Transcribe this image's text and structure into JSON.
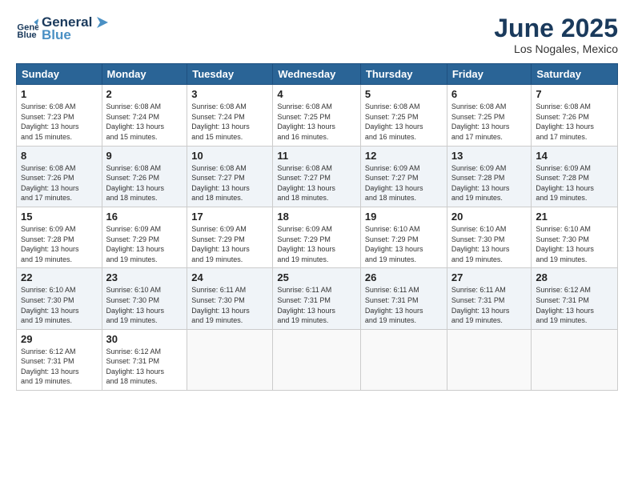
{
  "logo": {
    "line1": "General",
    "line2": "Blue"
  },
  "title": "June 2025",
  "location": "Los Nogales, Mexico",
  "weekdays": [
    "Sunday",
    "Monday",
    "Tuesday",
    "Wednesday",
    "Thursday",
    "Friday",
    "Saturday"
  ],
  "weeks": [
    [
      {
        "day": "1",
        "sunrise": "6:08 AM",
        "sunset": "7:23 PM",
        "daylight": "13 hours and 15 minutes."
      },
      {
        "day": "2",
        "sunrise": "6:08 AM",
        "sunset": "7:24 PM",
        "daylight": "13 hours and 15 minutes."
      },
      {
        "day": "3",
        "sunrise": "6:08 AM",
        "sunset": "7:24 PM",
        "daylight": "13 hours and 15 minutes."
      },
      {
        "day": "4",
        "sunrise": "6:08 AM",
        "sunset": "7:25 PM",
        "daylight": "13 hours and 16 minutes."
      },
      {
        "day": "5",
        "sunrise": "6:08 AM",
        "sunset": "7:25 PM",
        "daylight": "13 hours and 16 minutes."
      },
      {
        "day": "6",
        "sunrise": "6:08 AM",
        "sunset": "7:25 PM",
        "daylight": "13 hours and 17 minutes."
      },
      {
        "day": "7",
        "sunrise": "6:08 AM",
        "sunset": "7:26 PM",
        "daylight": "13 hours and 17 minutes."
      }
    ],
    [
      {
        "day": "8",
        "sunrise": "6:08 AM",
        "sunset": "7:26 PM",
        "daylight": "13 hours and 17 minutes."
      },
      {
        "day": "9",
        "sunrise": "6:08 AM",
        "sunset": "7:26 PM",
        "daylight": "13 hours and 18 minutes."
      },
      {
        "day": "10",
        "sunrise": "6:08 AM",
        "sunset": "7:27 PM",
        "daylight": "13 hours and 18 minutes."
      },
      {
        "day": "11",
        "sunrise": "6:08 AM",
        "sunset": "7:27 PM",
        "daylight": "13 hours and 18 minutes."
      },
      {
        "day": "12",
        "sunrise": "6:09 AM",
        "sunset": "7:27 PM",
        "daylight": "13 hours and 18 minutes."
      },
      {
        "day": "13",
        "sunrise": "6:09 AM",
        "sunset": "7:28 PM",
        "daylight": "13 hours and 19 minutes."
      },
      {
        "day": "14",
        "sunrise": "6:09 AM",
        "sunset": "7:28 PM",
        "daylight": "13 hours and 19 minutes."
      }
    ],
    [
      {
        "day": "15",
        "sunrise": "6:09 AM",
        "sunset": "7:28 PM",
        "daylight": "13 hours and 19 minutes."
      },
      {
        "day": "16",
        "sunrise": "6:09 AM",
        "sunset": "7:29 PM",
        "daylight": "13 hours and 19 minutes."
      },
      {
        "day": "17",
        "sunrise": "6:09 AM",
        "sunset": "7:29 PM",
        "daylight": "13 hours and 19 minutes."
      },
      {
        "day": "18",
        "sunrise": "6:09 AM",
        "sunset": "7:29 PM",
        "daylight": "13 hours and 19 minutes."
      },
      {
        "day": "19",
        "sunrise": "6:10 AM",
        "sunset": "7:29 PM",
        "daylight": "13 hours and 19 minutes."
      },
      {
        "day": "20",
        "sunrise": "6:10 AM",
        "sunset": "7:30 PM",
        "daylight": "13 hours and 19 minutes."
      },
      {
        "day": "21",
        "sunrise": "6:10 AM",
        "sunset": "7:30 PM",
        "daylight": "13 hours and 19 minutes."
      }
    ],
    [
      {
        "day": "22",
        "sunrise": "6:10 AM",
        "sunset": "7:30 PM",
        "daylight": "13 hours and 19 minutes."
      },
      {
        "day": "23",
        "sunrise": "6:10 AM",
        "sunset": "7:30 PM",
        "daylight": "13 hours and 19 minutes."
      },
      {
        "day": "24",
        "sunrise": "6:11 AM",
        "sunset": "7:30 PM",
        "daylight": "13 hours and 19 minutes."
      },
      {
        "day": "25",
        "sunrise": "6:11 AM",
        "sunset": "7:31 PM",
        "daylight": "13 hours and 19 minutes."
      },
      {
        "day": "26",
        "sunrise": "6:11 AM",
        "sunset": "7:31 PM",
        "daylight": "13 hours and 19 minutes."
      },
      {
        "day": "27",
        "sunrise": "6:11 AM",
        "sunset": "7:31 PM",
        "daylight": "13 hours and 19 minutes."
      },
      {
        "day": "28",
        "sunrise": "6:12 AM",
        "sunset": "7:31 PM",
        "daylight": "13 hours and 19 minutes."
      }
    ],
    [
      {
        "day": "29",
        "sunrise": "6:12 AM",
        "sunset": "7:31 PM",
        "daylight": "13 hours and 19 minutes."
      },
      {
        "day": "30",
        "sunrise": "6:12 AM",
        "sunset": "7:31 PM",
        "daylight": "13 hours and 18 minutes."
      },
      null,
      null,
      null,
      null,
      null
    ]
  ],
  "labels": {
    "sunrise": "Sunrise:",
    "sunset": "Sunset:",
    "daylight": "Daylight:"
  }
}
